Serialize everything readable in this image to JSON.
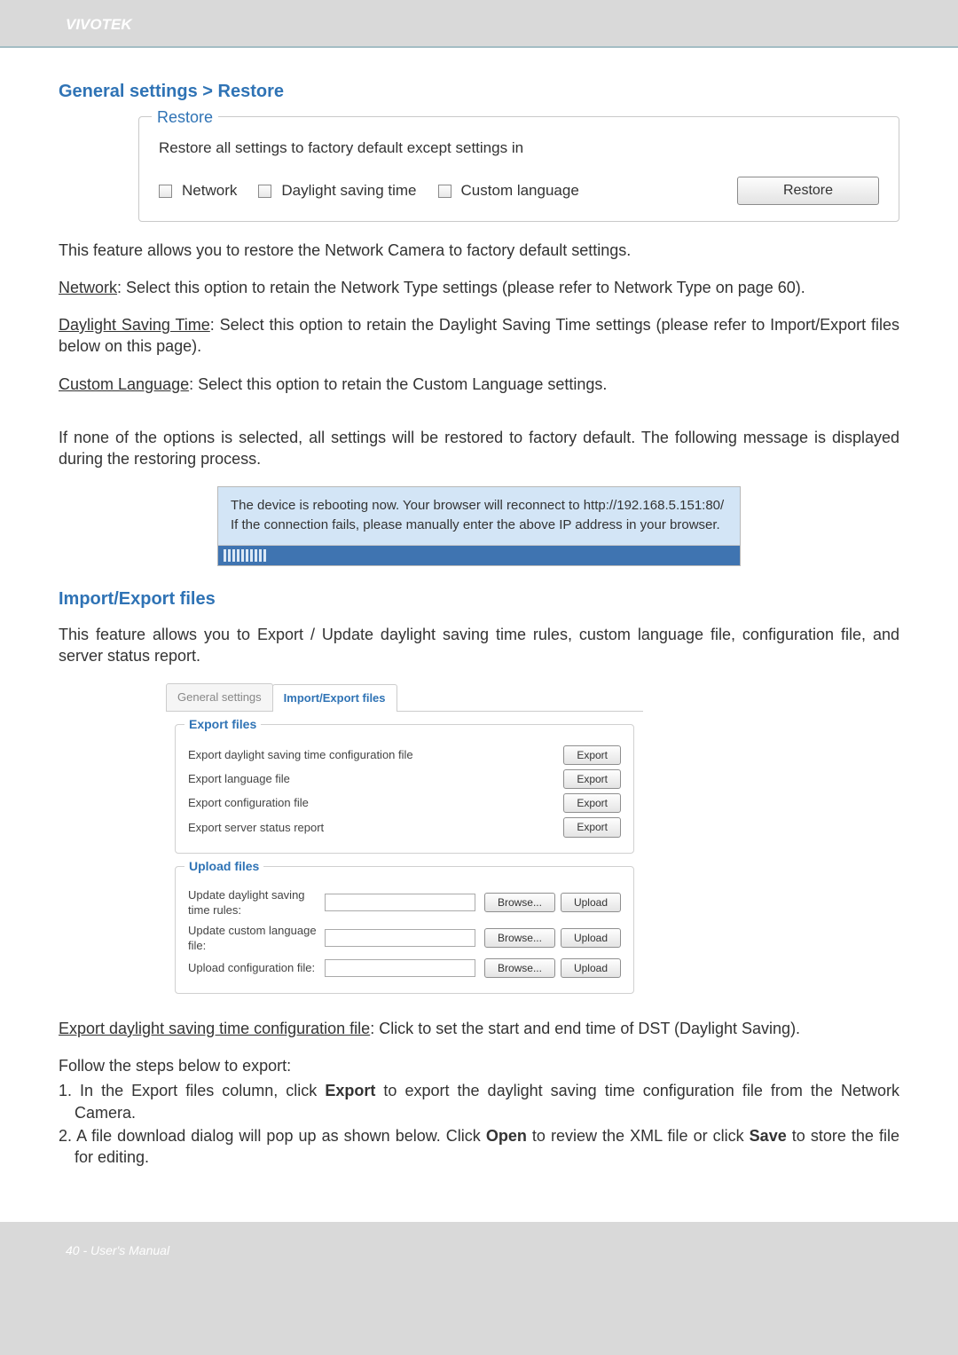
{
  "header": {
    "brand": "VIVOTEK"
  },
  "section1": {
    "title": "General settings > Restore",
    "restore": {
      "legend": "Restore",
      "desc": "Restore all settings to factory default except settings in",
      "opt_network": "Network",
      "opt_dst": "Daylight saving time",
      "opt_lang": "Custom language",
      "btn": "Restore"
    },
    "intro": "This feature allows you to restore the Network Camera to factory default settings.",
    "p_network_u": "Network",
    "p_network": ": Select this option to retain the Network Type settings (please refer to Network Type on page 60).",
    "p_dst_u": "Daylight Saving Time",
    "p_dst": ": Select this option to retain the Daylight Saving Time settings (please refer to Import/Export files below on this page).",
    "p_lang_u": "Custom Language",
    "p_lang": ": Select this option to retain the Custom Language settings.",
    "p_none": "If none of the options is selected, all settings will be restored to factory default.  The following message is displayed during the restoring process.",
    "reboot1": "The device is rebooting now. Your browser will reconnect to http://192.168.5.151:80/",
    "reboot2": "If the connection fails, please manually enter the above IP address in your browser."
  },
  "section2": {
    "title": "Import/Export files",
    "intro": "This feature allows you to Export / Update daylight saving time rules, custom language file, configuration file, and server status report.",
    "tabs": {
      "general": "General settings",
      "ie": "Import/Export files"
    },
    "export": {
      "legend": "Export files",
      "r1": "Export daylight saving time configuration file",
      "r2": "Export language file",
      "r3": "Export configuration file",
      "r4": "Export server status report",
      "btn": "Export"
    },
    "upload": {
      "legend": "Upload files",
      "r1": "Update daylight saving time rules:",
      "r2": "Update custom language file:",
      "r3": "Upload configuration file:",
      "browse": "Browse...",
      "upload": "Upload"
    },
    "p_export_u": "Export daylight saving time configuration file",
    "p_export": ": Click to set the start and end time of DST (Daylight Saving).",
    "steps_intro": "Follow the steps below to export:",
    "step1a": "1. In the Export files column, click ",
    "step1b": "Export",
    "step1c": " to export the daylight saving time configuration file from the Network Camera.",
    "step2a": "2. A file download dialog will pop up as shown below. Click ",
    "step2b": "Open",
    "step2c": " to review the XML file or click ",
    "step2d": "Save",
    "step2e": " to store the file for editing."
  },
  "footer": {
    "text": "40 - User's Manual"
  }
}
